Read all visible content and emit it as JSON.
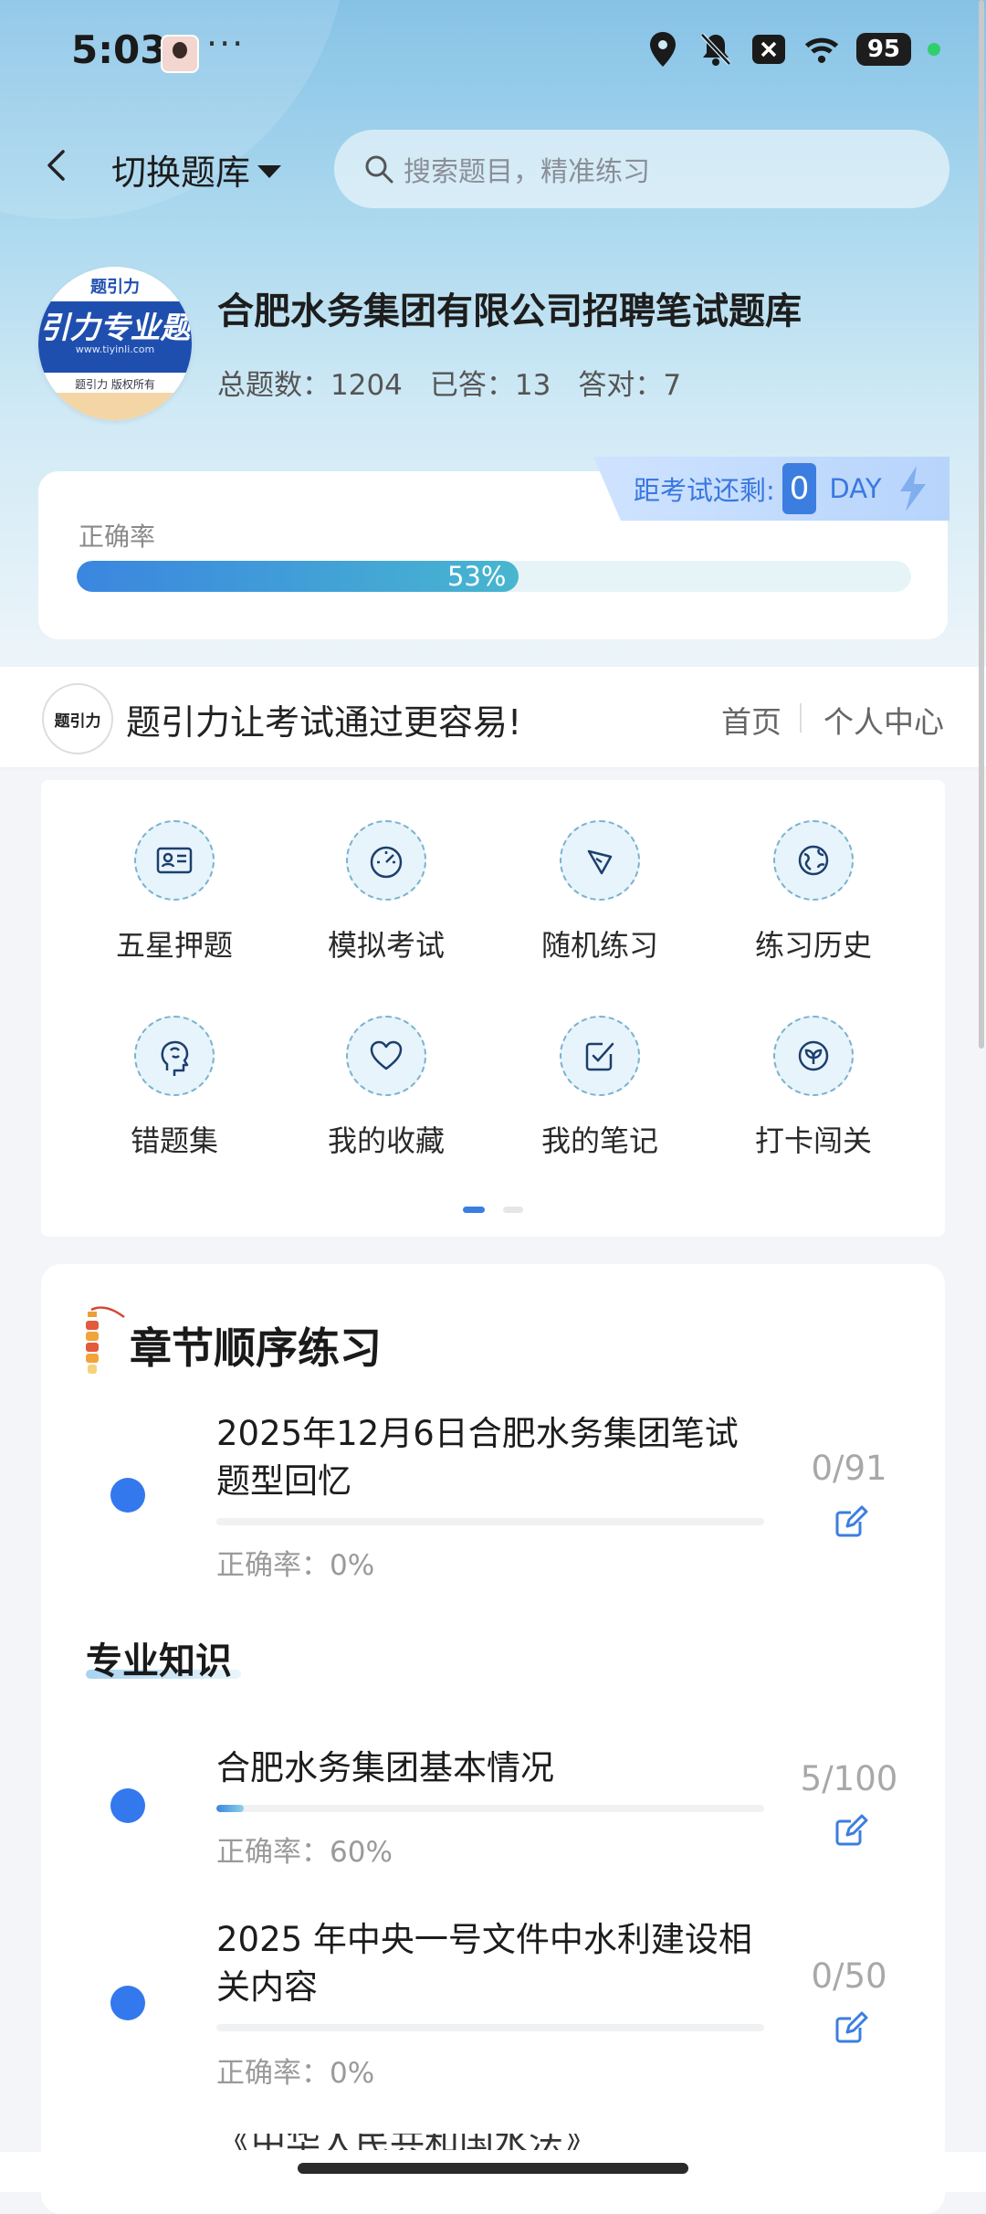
{
  "status_bar": {
    "time": "5:03",
    "more": "···",
    "battery": "95",
    "icons": [
      "avatar-icon",
      "location-icon",
      "bell-off-icon",
      "close-box-icon",
      "wifi-icon",
      "battery-icon",
      "status-dot-icon"
    ]
  },
  "header": {
    "switch_label": "切换题库",
    "search_placeholder": "搜索题目，精准练习"
  },
  "bank": {
    "logo_top": "题引力",
    "logo_title": "引力专业题",
    "logo_url": "www.tiyinli.com",
    "logo_sub": "题引力 版权所有",
    "title": "合肥水务集团有限公司招聘笔试题库",
    "stats": {
      "total": "总题数：1204",
      "answered": "已答：13",
      "correct": "答对：7"
    }
  },
  "accuracy": {
    "countdown_label": "距考试还剩:",
    "countdown_value": "0",
    "countdown_unit": "DAY",
    "label": "正确率",
    "percent_text": "53%",
    "percent_value": 0.53
  },
  "slogan": {
    "logo_text": "题引力",
    "text": "题引力让考试通过更容易!",
    "nav_home": "首页",
    "nav_user": "个人中心"
  },
  "functions": [
    {
      "label": "五星押题",
      "icon": "id-card-icon"
    },
    {
      "label": "模拟考试",
      "icon": "speedometer-icon"
    },
    {
      "label": "随机练习",
      "icon": "network-icon"
    },
    {
      "label": "练习历史",
      "icon": "globe-icon"
    },
    {
      "label": "错题集",
      "icon": "brain-head-icon"
    },
    {
      "label": "我的收藏",
      "icon": "heart-icon"
    },
    {
      "label": "我的笔记",
      "icon": "note-check-icon"
    },
    {
      "label": "打卡闯关",
      "icon": "sprout-icon"
    }
  ],
  "pager": {
    "active": 0,
    "total": 2
  },
  "chapters": {
    "title": "章节顺序练习",
    "section_title": "专业知识",
    "items": [
      {
        "title": "2025年12月6日合肥水务集团笔试题型回忆",
        "accuracy": "正确率：0%",
        "count": "0/91",
        "progress": 0
      },
      {
        "title": "合肥水务集团基本情况",
        "accuracy": "正确率：60%",
        "count": "5/100",
        "progress": 0.05
      },
      {
        "title": "2025 年中央一号文件中水利建设相关内容",
        "accuracy": "正确率：0%",
        "count": "0/50",
        "progress": 0
      }
    ],
    "partial_next": "《中华人民共和国水法》"
  },
  "colors": {
    "accent": "#3b7ee0",
    "row_dot": "#3478ee",
    "progress_start": "#3a86e0",
    "progress_end": "#48b6cf"
  }
}
